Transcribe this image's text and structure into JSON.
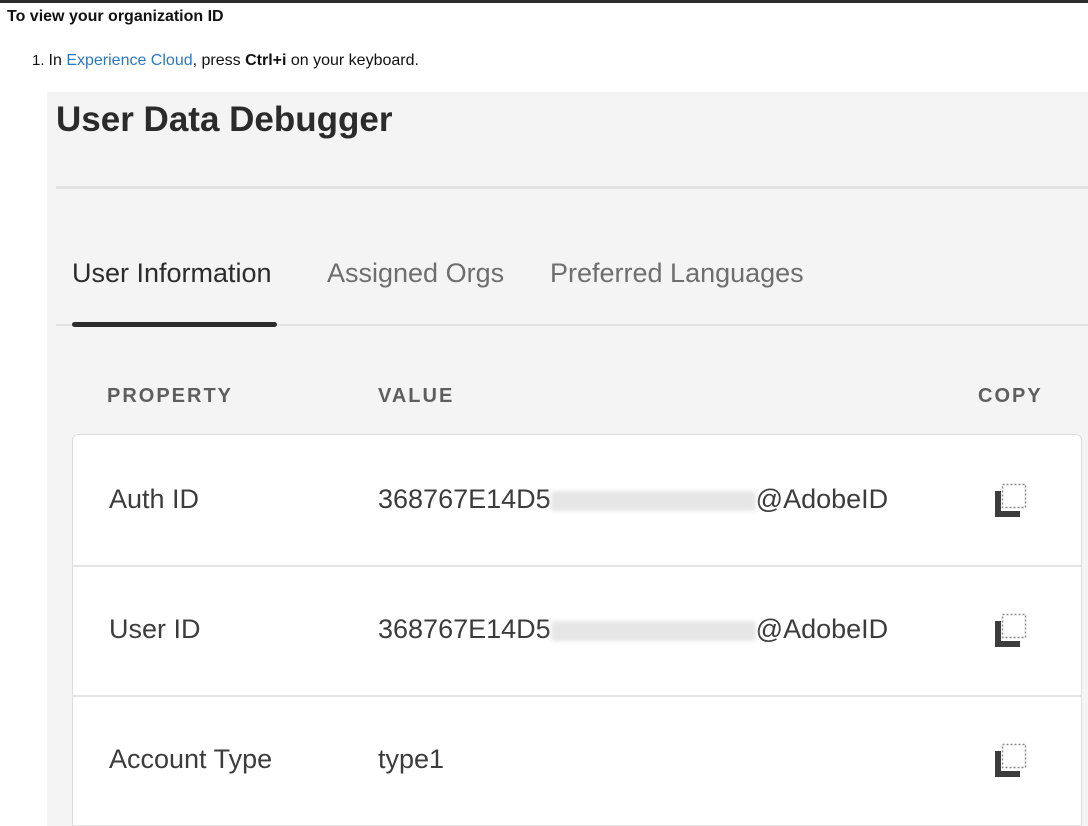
{
  "doc": {
    "heading": "To view your organization ID",
    "step_number": "1.",
    "step_prefix": "In ",
    "step_link": "Experience Cloud",
    "step_middle": ", press ",
    "step_shortcut": "Ctrl+i",
    "step_suffix": " on your keyboard."
  },
  "dialog": {
    "title": "User Data Debugger",
    "tabs": [
      {
        "label": "User Information",
        "active": true
      },
      {
        "label": "Assigned Orgs",
        "active": false
      },
      {
        "label": "Preferred Languages",
        "active": false
      }
    ],
    "columns": {
      "property": "PROPERTY",
      "value": "VALUE",
      "copy": "COPY"
    },
    "rows": [
      {
        "property": "Auth ID",
        "value_prefix": "368767E14D5",
        "value_suffix": "@AdobeID",
        "redacted": true
      },
      {
        "property": "User ID",
        "value_prefix": "368767E14D5",
        "value_suffix": "@AdobeID",
        "redacted": true
      },
      {
        "property": "Account Type",
        "value_prefix": "type1",
        "value_suffix": "",
        "redacted": false
      }
    ]
  },
  "icons": {
    "copy": "copy-icon"
  },
  "colors": {
    "link": "#2d78c4",
    "active_tab": "#2c2c2c",
    "inactive_tab": "#6e6e6e"
  }
}
